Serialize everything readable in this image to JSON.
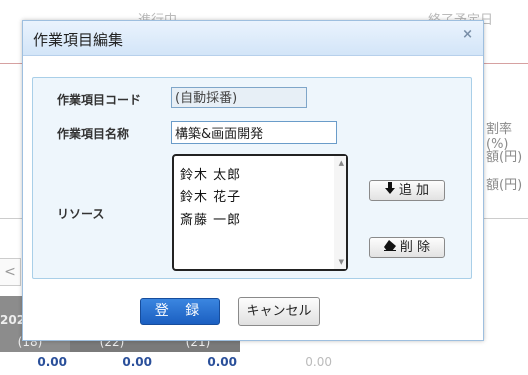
{
  "background": {
    "column_a": "進行中",
    "column_b": "終了予定日",
    "right_labels": [
      "割率(%)",
      "額(円)",
      "額(円)"
    ],
    "pager_prev": "<",
    "grid_year": "202",
    "grid_counts": [
      "(18)",
      "(22)",
      "(21)"
    ],
    "grid_values": [
      "0.00",
      "0.00",
      "0.00",
      "0.00"
    ]
  },
  "dialog": {
    "title": "作業項目編集",
    "close_glyph": "×",
    "code_label": "作業項目コード",
    "code_value": "(自動採番)",
    "name_label": "作業項目名称",
    "name_value": "構築&画面開発",
    "resource_label": "リソース",
    "resources": [
      "鈴木 太郎",
      "鈴木 花子",
      "斎藤 一郎"
    ],
    "add_label": "追 加",
    "delete_label": "削 除",
    "save_label": "登 録",
    "cancel_label": "キャンセル"
  },
  "icons": {
    "add": "arrow-down-icon",
    "delete": "eraser-icon"
  }
}
